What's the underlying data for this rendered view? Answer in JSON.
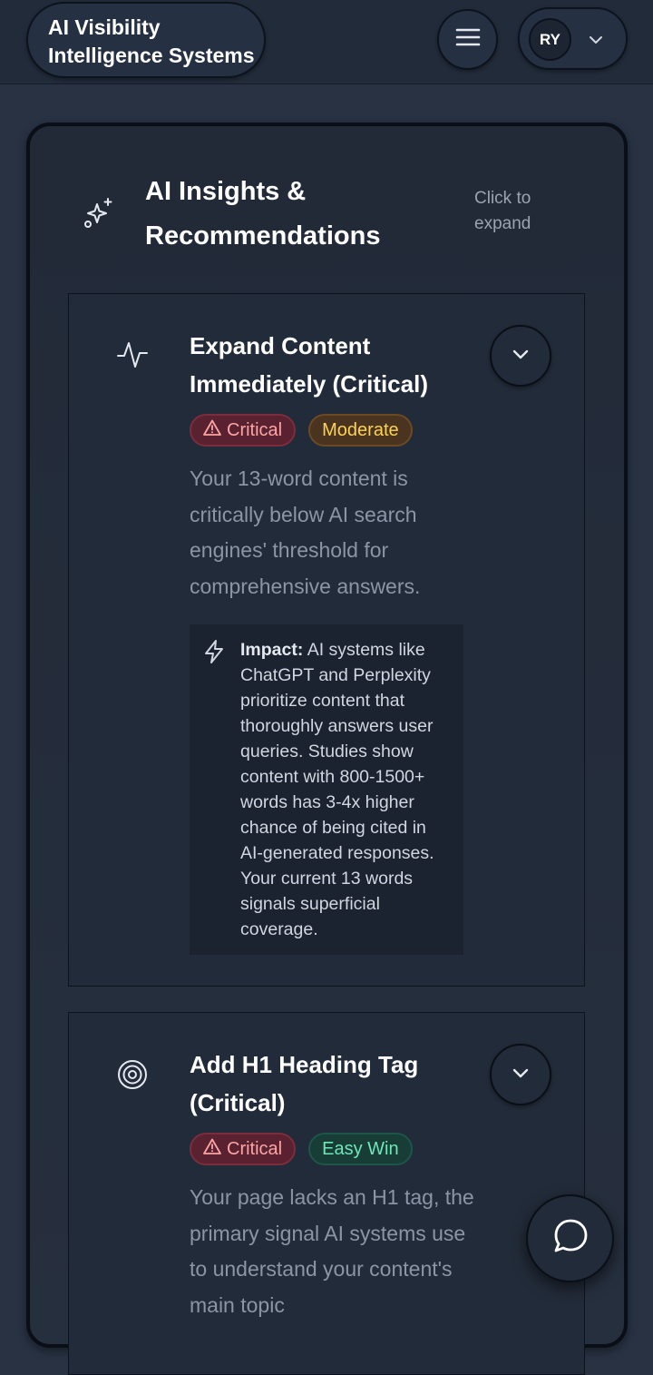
{
  "header": {
    "brand": "AI Visibility Intelligence Systems",
    "user_initials": "RY",
    "menu_icon": "hamburger-icon",
    "dropdown_icon": "chevron-down-icon"
  },
  "insights": {
    "title": "AI Insights & Recommendations",
    "expand_hint": "Click to expand",
    "icon": "sparkles-icon",
    "items": [
      {
        "title": "Expand Content Immediately (Critical)",
        "icon": "activity-icon",
        "badges": [
          {
            "label": "Critical",
            "kind": "critical",
            "icon": "warning-triangle-icon"
          },
          {
            "label": "Moderate",
            "kind": "moderate"
          }
        ],
        "description": "Your 13-word content is critically below AI search engines' threshold for comprehensive answers.",
        "impact_label": "Impact:",
        "impact_text": " AI systems like ChatGPT and Perplexity prioritize content that thoroughly answers user queries. Studies show content with 800-1500+ words has 3-4x higher chance of being cited in AI-generated responses. Your current 13 words signals superficial coverage."
      },
      {
        "title": "Add H1 Heading Tag (Critical)",
        "icon": "target-icon",
        "badges": [
          {
            "label": "Critical",
            "kind": "critical",
            "icon": "warning-triangle-icon"
          },
          {
            "label": "Easy Win",
            "kind": "easy"
          }
        ],
        "description": "Your page lacks an H1 tag, the primary signal AI systems use to understand your content's main topic"
      }
    ]
  },
  "colors": {
    "background": "#283243",
    "panel": "#222a38",
    "critical": "#fca5a5",
    "moderate": "#fcd34d",
    "easy_win": "#6ee7b7"
  },
  "chat": {
    "icon": "chat-bubble-icon"
  }
}
